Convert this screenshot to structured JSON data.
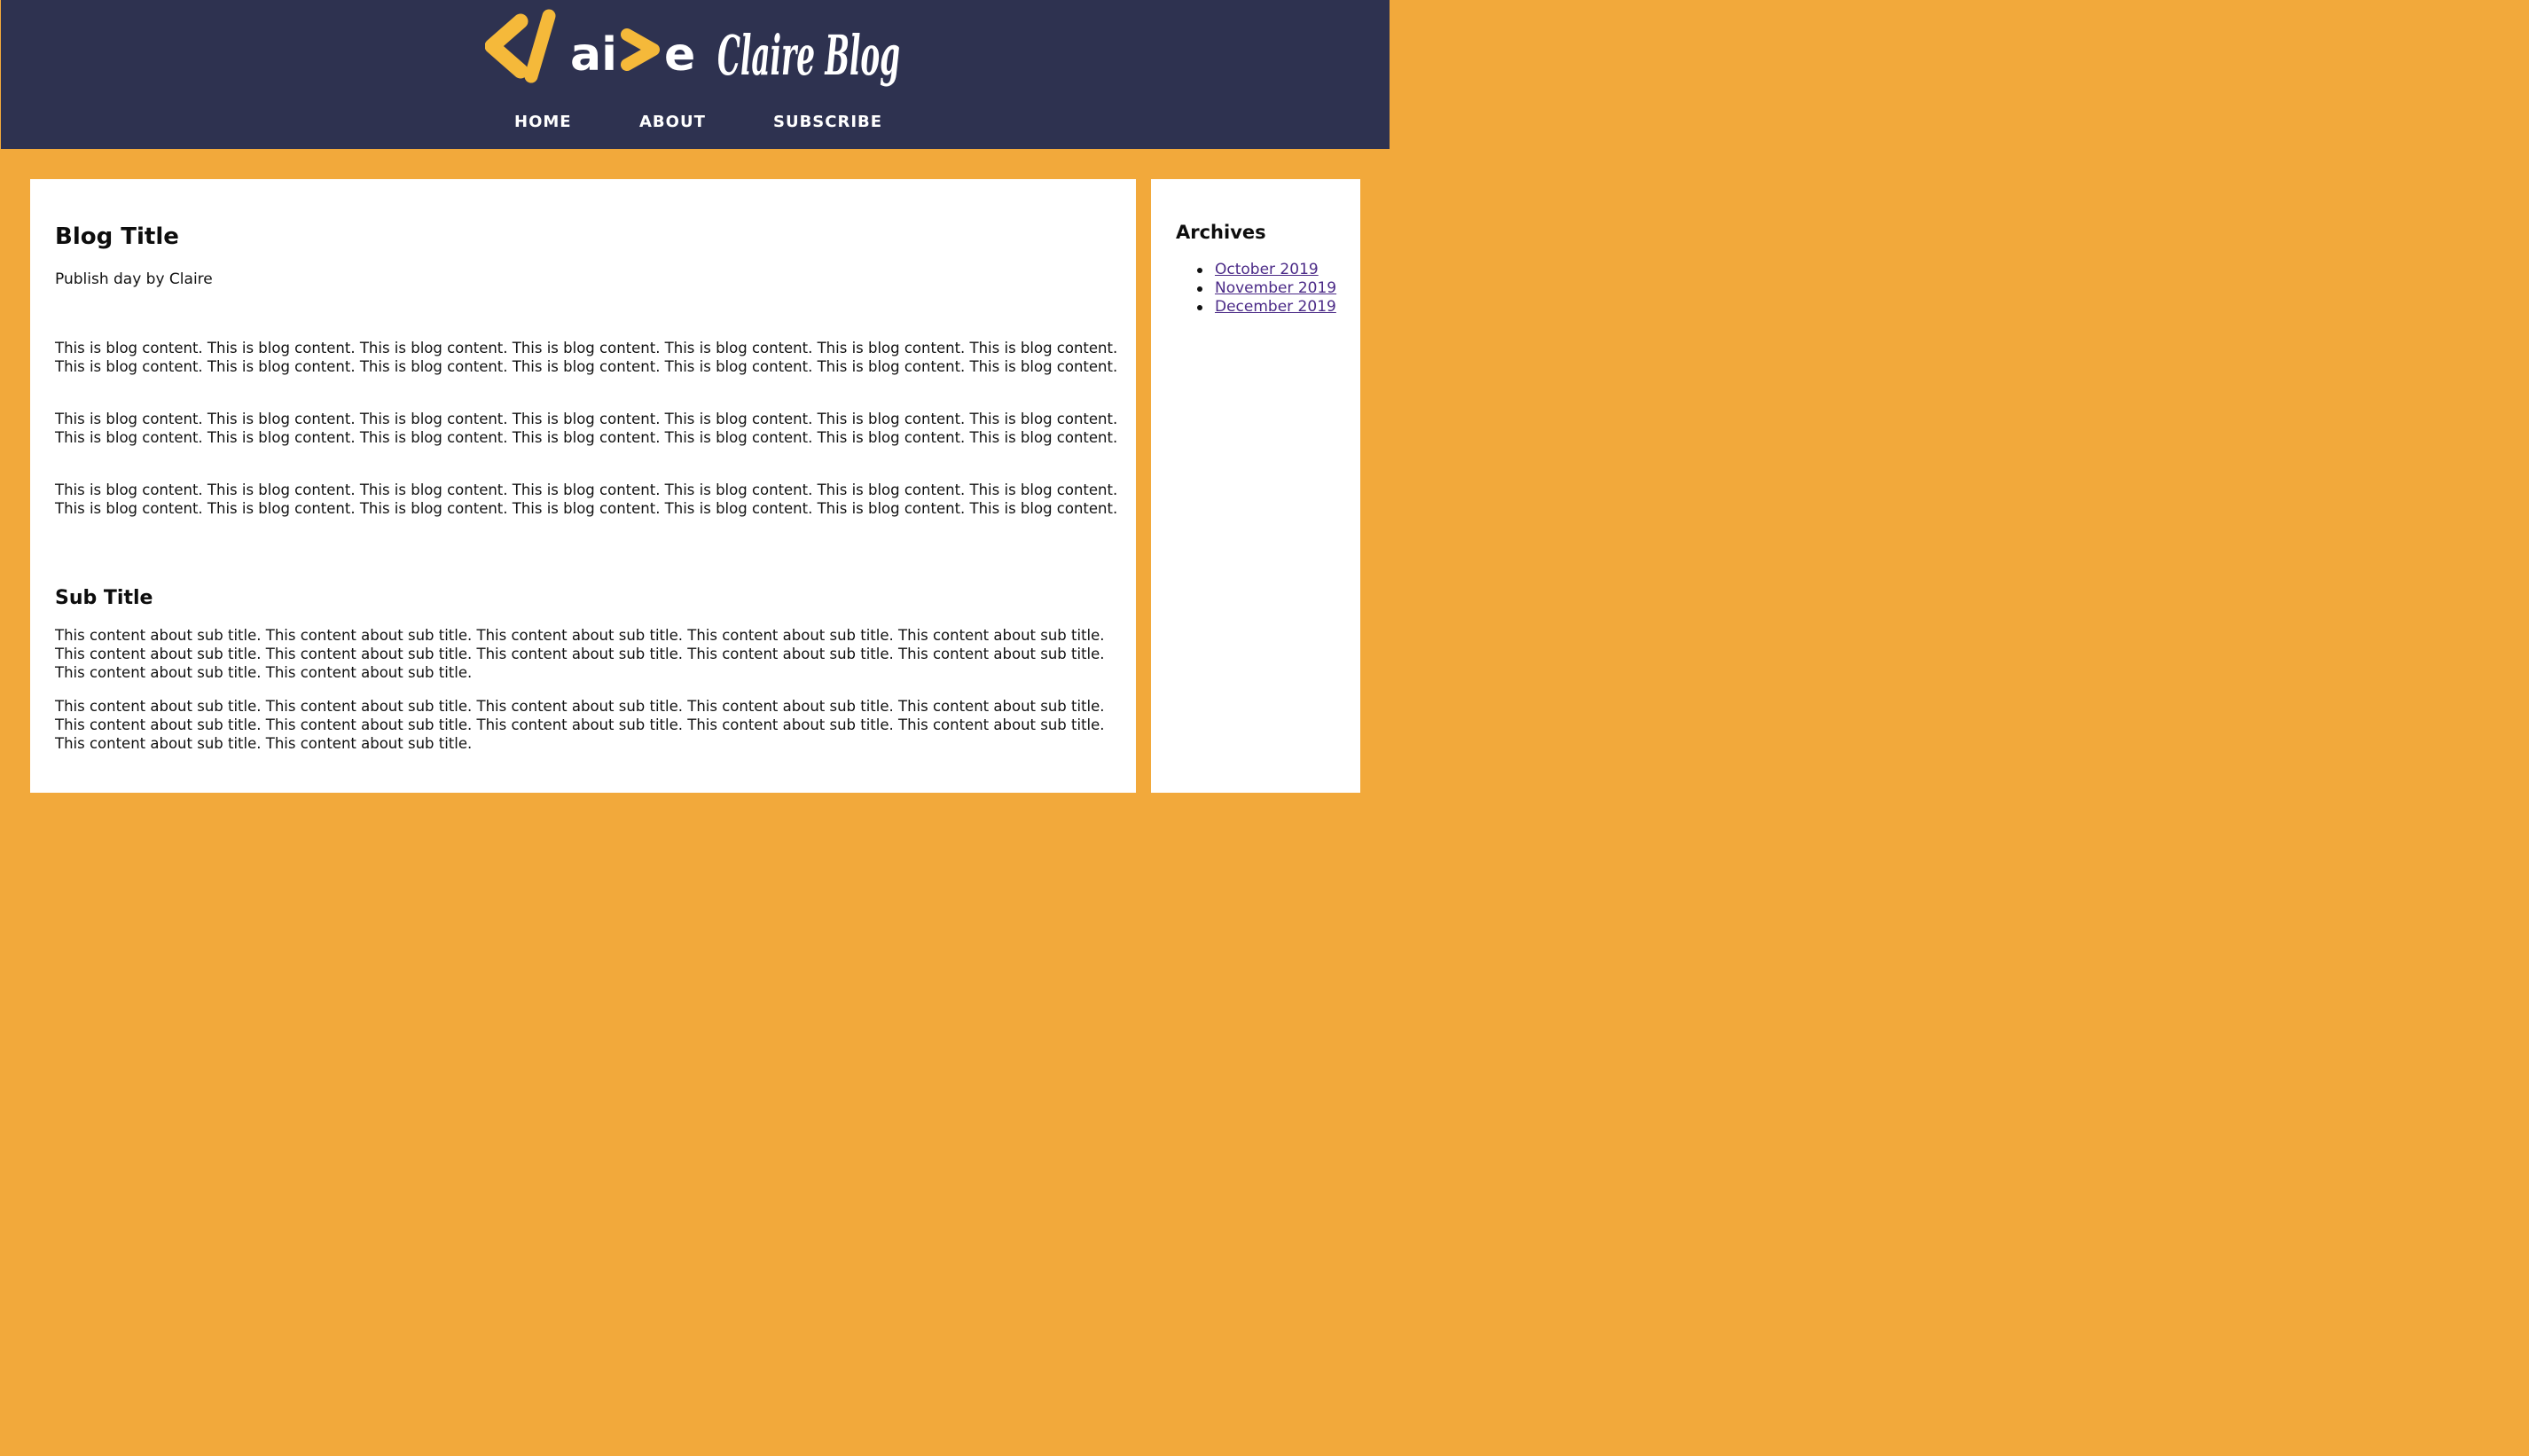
{
  "header": {
    "logo_text": "Claire Blog",
    "nav": [
      {
        "label": "HOME"
      },
      {
        "label": "ABOUT"
      },
      {
        "label": "SUBSCRIBE"
      }
    ]
  },
  "post": {
    "title": "Blog Title",
    "meta": "Publish day by Claire",
    "paragraphs": [
      "This is blog content. This is blog content. This is blog content. This is blog content. This is blog content. This is blog content. This is blog content. This is blog content. This is blog content. This is blog content. This is blog content. This is blog content. This is blog content. This is blog content.",
      "This is blog content. This is blog content. This is blog content. This is blog content. This is blog content. This is blog content. This is blog content. This is blog content. This is blog content. This is blog content. This is blog content. This is blog content. This is blog content. This is blog content.",
      "This is blog content. This is blog content. This is blog content. This is blog content. This is blog content. This is blog content. This is blog content. This is blog content. This is blog content. This is blog content. This is blog content. This is blog content. This is blog content. This is blog content."
    ],
    "sub_title": "Sub Title",
    "sub_paragraphs": [
      "This content about sub title. This content about sub title. This content about sub title. This content about sub title. This content about sub title. This content about sub title. This content about sub title. This content about sub title. This content about sub title. This content about sub title. This content about sub title. This content about sub title.",
      "This content about sub title. This content about sub title. This content about sub title. This content about sub title. This content about sub title. This content about sub title. This content about sub title. This content about sub title. This content about sub title. This content about sub title. This content about sub title. This content about sub title."
    ]
  },
  "sidebar": {
    "title": "Archives",
    "links": [
      {
        "label": "October 2019"
      },
      {
        "label": "November 2019"
      },
      {
        "label": "December 2019"
      }
    ]
  },
  "colors": {
    "header_bg": "#2e3250",
    "page_bg": "#f2a93b",
    "logo_accent": "#f5b93a",
    "logo_text": "#ffffff",
    "link": "#4b2a87"
  }
}
